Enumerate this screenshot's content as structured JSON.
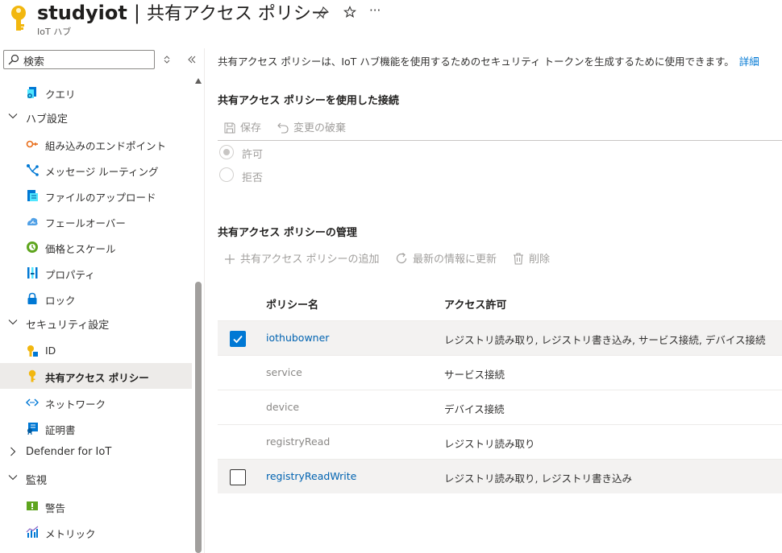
{
  "header": {
    "resource_name": "studyiot",
    "separator": "|",
    "page_title": "共有アクセス ポリシー",
    "subtitle": "IoT ハブ",
    "pin_icon": "pin-icon",
    "star_icon": "star-icon",
    "more_label": "···"
  },
  "sidebar": {
    "search_placeholder": "検索",
    "items": [
      {
        "label": "クエリ",
        "icon": "query-icon"
      },
      {
        "label": "ハブ設定",
        "group": true
      },
      {
        "label": "組み込みのエンドポイント",
        "icon": "endpoint-icon"
      },
      {
        "label": "メッセージ ルーティング",
        "icon": "routing-icon"
      },
      {
        "label": "ファイルのアップロード",
        "icon": "file-upload-icon"
      },
      {
        "label": "フェールオーバー",
        "icon": "failover-icon"
      },
      {
        "label": "価格とスケール",
        "icon": "pricing-icon"
      },
      {
        "label": "プロパティ",
        "icon": "properties-icon"
      },
      {
        "label": "ロック",
        "icon": "lock-icon"
      },
      {
        "label": "セキュリティ設定",
        "group": true
      },
      {
        "label": "ID",
        "icon": "identity-icon"
      },
      {
        "label": "共有アクセス ポリシー",
        "icon": "key-icon",
        "selected": true
      },
      {
        "label": "ネットワーク",
        "icon": "network-icon"
      },
      {
        "label": "証明書",
        "icon": "certificate-icon"
      },
      {
        "label": "Defender for IoT",
        "group": true,
        "collapsed": true
      },
      {
        "label": "監視",
        "group": true
      },
      {
        "label": "警告",
        "icon": "alert-icon"
      },
      {
        "label": "メトリック",
        "icon": "metrics-icon"
      }
    ]
  },
  "main": {
    "description": "共有アクセス ポリシーは、IoT ハブ機能を使用するためのセキュリティ トークンを生成するために使用できます。",
    "description_link": "詳細",
    "connection_section": {
      "title": "共有アクセス ポリシーを使用した接続",
      "save_label": "保存",
      "discard_label": "変更の破棄",
      "allow_label": "許可",
      "deny_label": "拒否",
      "selected": "許可"
    },
    "manage_section": {
      "title": "共有アクセス ポリシーの管理",
      "add_label": "共有アクセス ポリシーの追加",
      "refresh_label": "最新の情報に更新",
      "delete_label": "削除"
    },
    "table": {
      "col_name": "ポリシー名",
      "col_permissions": "アクセス許可",
      "rows": [
        {
          "name": "iothubowner",
          "permissions": "レジストリ読み取り, レジストリ書き込み, サービス接続, デバイス接続",
          "checked": true
        },
        {
          "name": "service",
          "permissions": "サービス接続",
          "checked": false
        },
        {
          "name": "device",
          "permissions": "デバイス接続",
          "checked": false
        },
        {
          "name": "registryRead",
          "permissions": "レジストリ読み取り",
          "checked": false
        },
        {
          "name": "registryReadWrite",
          "permissions": "レジストリ読み取り, レジストリ書き込み",
          "checked": false
        }
      ]
    }
  },
  "colors": {
    "accent": "#0078d4",
    "link": "#0063b1",
    "key_gold": "#f2b70f",
    "selected_bg": "#edebe9"
  }
}
